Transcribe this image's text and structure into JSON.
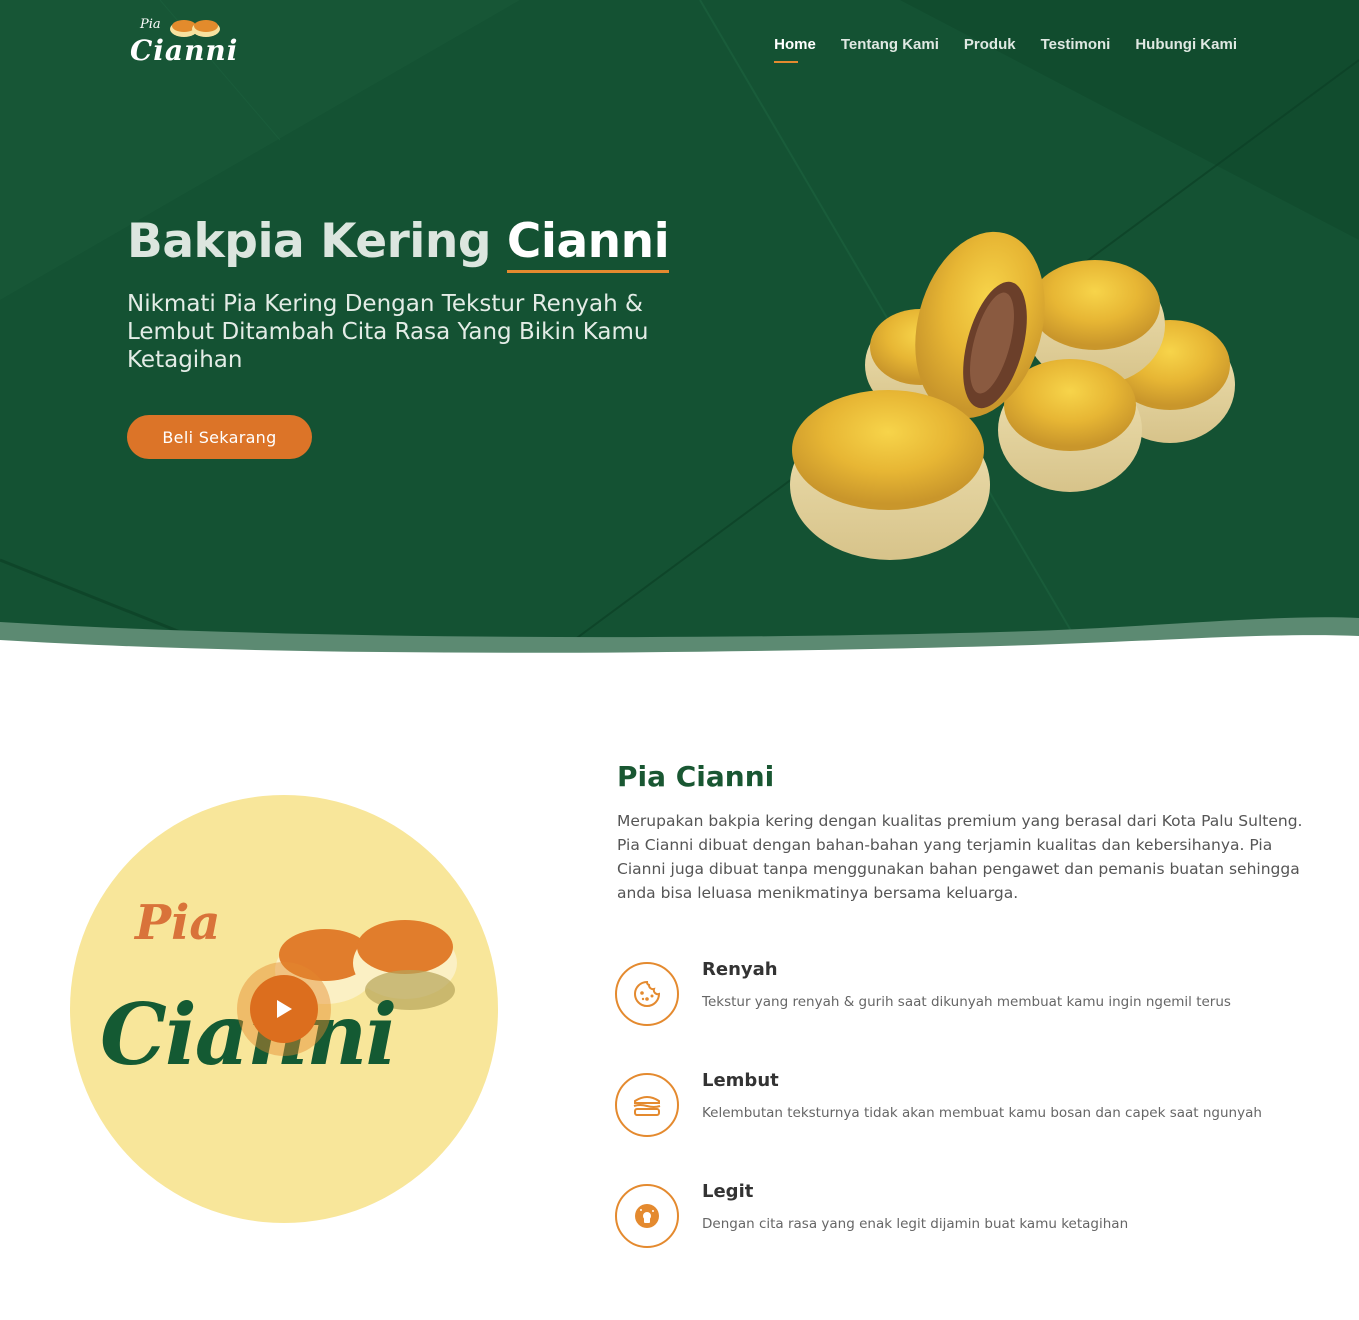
{
  "brand": {
    "logo_small": "Pia",
    "logo_large": "Cianni"
  },
  "nav": {
    "items": [
      {
        "label": "Home",
        "active": true
      },
      {
        "label": "Tentang Kami",
        "active": false
      },
      {
        "label": "Produk",
        "active": false
      },
      {
        "label": "Testimoni",
        "active": false
      },
      {
        "label": "Hubungi Kami",
        "active": false
      }
    ]
  },
  "hero": {
    "title_main": "Bakpia Kering ",
    "title_accent": "Cianni",
    "subtitle": "Nikmati Pia Kering Dengan Tekstur Renyah & Lembut Ditambah Cita Rasa Yang Bikin Kamu Ketagihan",
    "cta_label": "Beli Sekarang"
  },
  "video": {
    "logo_small": "Pia",
    "logo_large": "Cianni",
    "play_icon": "play-icon"
  },
  "about": {
    "title": "Pia Cianni",
    "text": "Merupakan bakpia kering dengan kualitas premium yang berasal dari Kota Palu Sulteng. Pia Cianni dibuat dengan bahan-bahan yang terjamin kualitas dan kebersihanya. Pia Cianni juga dibuat tanpa menggunakan bahan pengawet dan pemanis buatan sehingga anda bisa leluasa menikmatinya bersama keluarga."
  },
  "features": [
    {
      "icon": "cookie-icon",
      "title": "Renyah",
      "desc": "Tekstur yang renyah & gurih saat dikunyah membuat kamu ingin ngemil terus"
    },
    {
      "icon": "sandwich-icon",
      "title": "Lembut",
      "desc": "Kelembutan teksturnya tidak akan membuat kamu bosan dan capek saat ngunyah"
    },
    {
      "icon": "donut-icon",
      "title": "Legit",
      "desc": "Dengan cita rasa yang enak legit dijamin buat kamu ketagihan"
    }
  ],
  "colors": {
    "primary_green": "#145233",
    "accent_orange": "#dc7428",
    "video_bg": "#f8e69a"
  }
}
